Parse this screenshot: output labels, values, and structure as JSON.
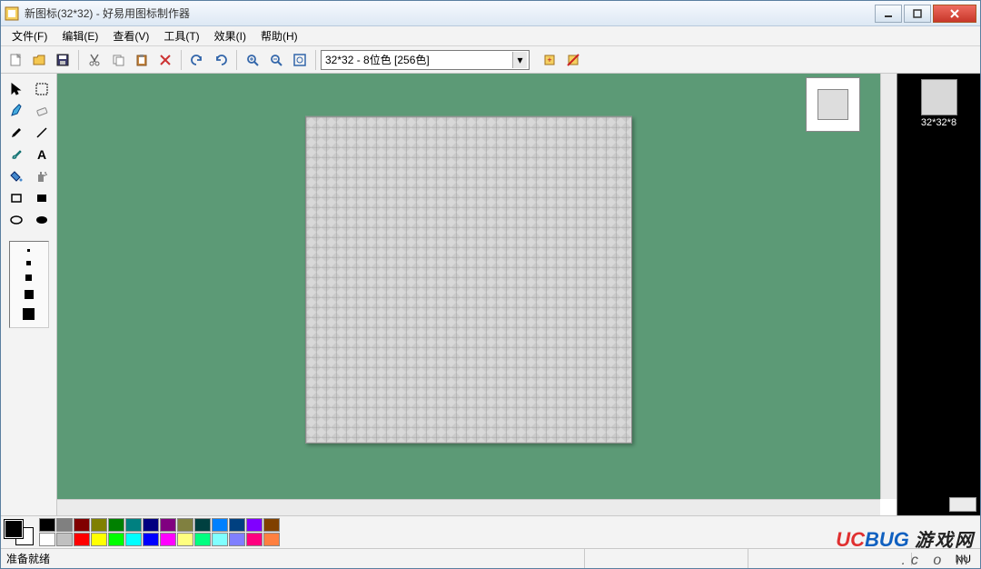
{
  "title": "新图标(32*32)  - 好易用图标制作器",
  "menus": [
    "文件(F)",
    "编辑(E)",
    "查看(V)",
    "工具(T)",
    "效果(I)",
    "帮助(H)"
  ],
  "dropdown": "32*32 - 8位色 [256色]",
  "side_label": "32*32*8",
  "status": {
    "left": "准备就绪",
    "right": "NU"
  },
  "palette_row1": [
    "#000000",
    "#808080",
    "#800000",
    "#808000",
    "#008000",
    "#008080",
    "#000080",
    "#800080",
    "#808040",
    "#004040",
    "#0080ff",
    "#004080",
    "#8000ff",
    "#804000"
  ],
  "palette_row2": [
    "#ffffff",
    "#c0c0c0",
    "#ff0000",
    "#ffff00",
    "#00ff00",
    "#00ffff",
    "#0000ff",
    "#ff00ff",
    "#ffff80",
    "#00ff80",
    "#80ffff",
    "#8080ff",
    "#ff0080",
    "#ff8040"
  ],
  "watermark": {
    "a": "UC",
    "b": "BUG",
    "c": "游戏网",
    "d": ".c  o  m"
  }
}
